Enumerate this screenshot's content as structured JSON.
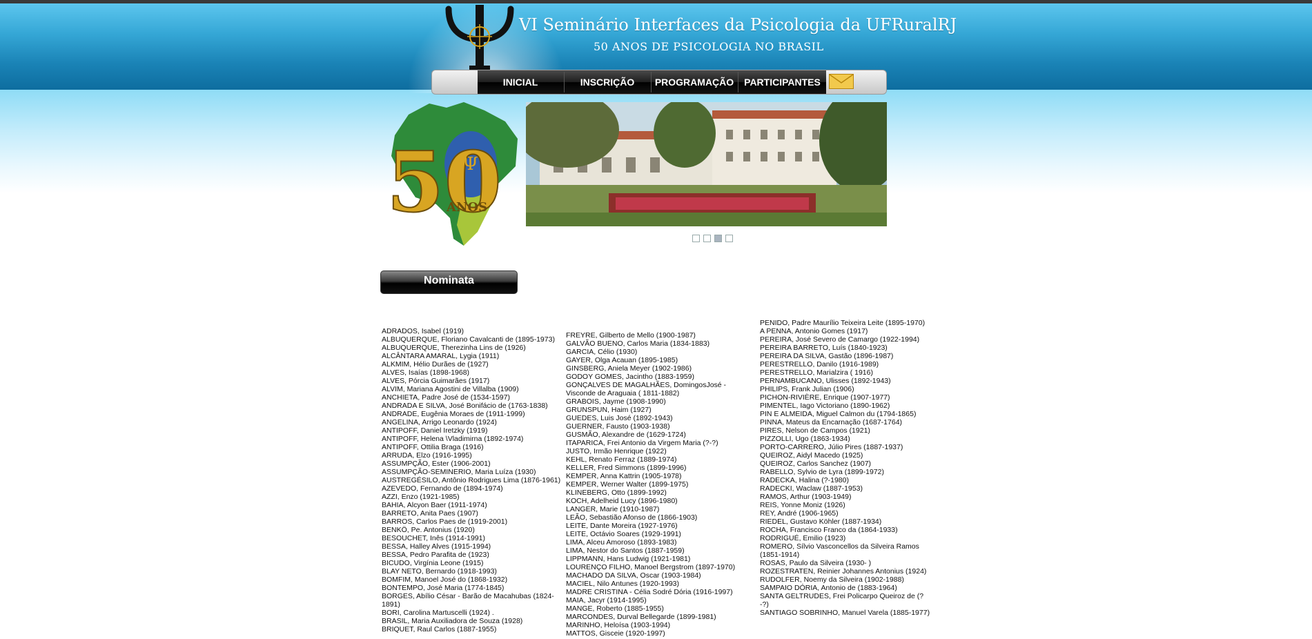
{
  "header": {
    "title": "VI Seminário Interfaces da Psicologia da UFRuralRJ",
    "subtitle": "50 ANOS DE PSICOLOGIA NO BRASIL"
  },
  "nav": {
    "items": [
      "INICIAL",
      "INSCRIÇÃO",
      "PROGRAMAÇÃO",
      "PARTICIPANTES"
    ]
  },
  "badge": {
    "number": "50",
    "text": "ANOS"
  },
  "slider": {
    "count": 4,
    "active": 3
  },
  "section": {
    "title": "Nominata"
  },
  "names": {
    "col1": [
      "ADRADOS, Isabel (1919)",
      "ALBUQUERQUE, Floriano Cavalcanti de (1895-1973)",
      "ALBUQUERQUE, Therezinha Lins de (1926)",
      "ALCÂNTARA AMARAL, Lygia (1911)",
      "ALKMIM, Hélio Durães de (1927)",
      "ALVES, Isaías (1898-1968)",
      "ALVES, Pórcia Guimarães (1917)",
      "ALVIM, Mariana Agostini de Villalba (1909)",
      "ANCHIETA, Padre José de (1534-1597)",
      "ANDRADA E SILVA, José Bonifácio de (1763-1838)",
      "ANDRADE, Eugênia Moraes de (1911-1999)",
      "ANGELINA, Arrigo Leonardo (1924)",
      "ANTIPOFF, Daniel Iretzky (1919)",
      "ANTIPOFF, Helena \\Vladimirna (1892-1974)",
      "ANTIPOFF, Ottilia Braga (1916)",
      "ARRUDA, Elzo (1916-1995)",
      "ASSUMPÇÃO, Ester (1906-2001)",
      "ASSUMPÇÃO-SEMINERIO, Maria Luíza (1930)",
      "AUSTREGÉSILO, Antônio Rodrigues Lima (1876-1961)",
      "AZEVEDO, Fernando de (1894-1974)",
      "AZZI, Enzo (1921-1985)",
      "BAHIA, Alcyon Baer (1911-1974)",
      "BARRETO, Anita Paes (1907)",
      "BARROS, Carlos Paes de (1919-2001)",
      "BENKÖ, Pe. Antonius (1920)",
      "BESOUCHET, Inês (1914-1991)",
      "BESSA, Halley Alves (1915-1994)",
      "BESSA, Pedro Parafita de (1923)",
      "BICUDO, Virgínia Leone (1915)",
      "BLAY NETO, Bernardo (1918-1993)",
      "BOMFIM, Manoel José do (1868-1932)",
      "BONTEMPO, José Maria (1774-1845)",
      "BORGES, Abílio César - Barão de Macahubas (1824-1891)",
      "BORI, Carolina Martuscelli (1924) .",
      "BRASIL, Maria Auxiliadora de Souza (1928)",
      "BRIQUET, Raul Carlos (1887-1955)"
    ],
    "col2": [
      "FREYRE, Gilberto de Mello (1900-1987)",
      "GALVÃO BUENO, Carlos Maria (1834-1883)",
      "GARCIA, Célio (1930)",
      "GAYER, Olga Acauan (1895-1985)",
      "GINSBERG, Aniela Meyer (1902-1986)",
      "GODOY GOMES, Jacintho (1883-1959)",
      "GONÇALVES DE MAGALHÃES, DomingosJosé - Visconde de Araguaia ( 1811-1882)",
      "GRABOIS, Jayme (1908-1990)",
      "GRUNSPUN, Haim (1927)",
      "GUEDES, Luis José (1892-1943)",
      "GUERNER, Fausto (1903-1938)",
      "GUSMÃO, Alexandre de (1629-1724)",
      "ITAPARICA, Frei Antonio da Virgem Maria (?-?)",
      "JUSTO, Irmão Henrique (1922)",
      "KEHL, Renato Ferraz (1889-1974)",
      "KELLER, Fred Simmons (1899-1996)",
      "KEMPER, Anna Kattrin (1905-1978)",
      "KEMPER, Werner Walter (1899-1975)",
      "KLINEBERG, Otto (1899-1992)",
      "KOCH, Adelheid Lucy (1896-1980)",
      "LANGER, Marie (1910-1987)",
      "LEÃO, Sebastião Afonso de (1866-1903)",
      "LEITE, Dante Moreira (1927-1976)",
      "LEITE, Octávio Soares (1929-1991)",
      "LIMA, Alceu Amoroso (1893-1983)",
      "LIMA, Nestor do Santos (1887-1959)",
      "LIPPMANN, Hans Ludwig (1921-1981)",
      "LOURENÇO FILHO, Manoel Bergstrom (1897-1970)",
      "MACHADO DA SILVA, Oscar (1903-1984)",
      "MACIEL, Nilo Antunes (1920-1993)",
      "MADRE CRISTINA - Célia Sodré Dória (1916-1997)",
      "MAIA, Jacyr (1914-1995)",
      "MANGE, Roberto (1885-1955)",
      "MARCONDES, Durval Bellegarde (1899-1981)",
      "MARINHO, Heloísa (1903-1994)",
      "MATTOS, Gisceie (1920-1997)"
    ],
    "col3": [
      "PENIDO, Padre Maurílio Teixeira Leite (1895-1970)",
      "A PENNA, Antonio Gomes (1917)",
      "PEREIRA, José Severo de Camargo (1922-1994)",
      "PEREIRA BARRETO, Luís (1840-1923)",
      "PEREIRA DA SILVA, Gastão (1896-1987)",
      "PERESTRELLO, Danilo (1916-1989)",
      "PERESTRELLO, Marialzira ( 1916)",
      "PERNAMBUCANO, Ulisses (1892-1943)",
      "PHILIPS, Frank Julian (1906)",
      "PICHON-RIVIÈRE, Enrique (1907-1977)",
      "PIMENTEL, Iago Victoriano (1890-1962)",
      "PIN E ALMEIDA, Miguel Calmon du (1794-1865)",
      "PINNA, Mateus da Encarnação (1687-1764)",
      "PIRES, Nelson de Campos (1921)",
      "PIZZOLLI, Ugo (1863-1934)",
      "PORTO-CARRERO, Júlio Pires (1887-1937)",
      "QUEIROZ, Aidyl Macedo (1925)",
      "QUEIROZ, Carlos Sanchez (1907)",
      "RABELLO, Sylvio de Lyra (1899-1972)",
      "RADECKA, Halina (?-1980)",
      "RADECKI, Waclaw (1887-1953)",
      "RAMOS, Arthur (1903-1949)",
      "REIS, Yonne Moniz (1926)",
      "REY, André (1906-1965)",
      "RIEDEL, Gustavo Köhler (1887-1934)",
      "ROCHA, Francisco Franco da (1864-1933)",
      "RODRIGUÉ, Emilio (1923)",
      "ROMERO, Sílvio Vasconcellos da Silveira Ramos (1851-1914)",
      "ROSAS, Paulo da Silveira (1930- )",
      "ROZESTRATEN, Reinier Johannes Antonius (1924)",
      "RUDOLFER, Noemy da Silveira (1902-1988)",
      "SAMPAIO DÓRIA, Antonio de (1883-1964)",
      "SANTA GELTRUDES, Frei Policarpo Queiroz de (?-?)",
      "SANTIAGO SOBRINHO, Manuel Varela (1885-1977)"
    ]
  }
}
